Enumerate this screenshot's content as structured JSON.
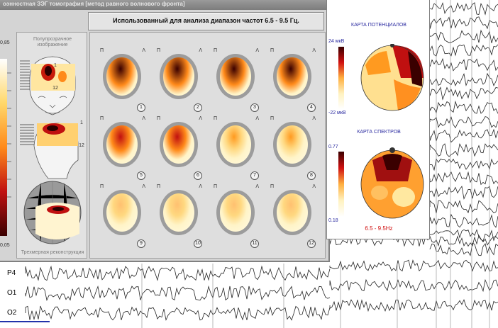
{
  "window": {
    "title": "оэнностная ЗЭГ томография [метод равного волнового фронта]"
  },
  "header": {
    "range_text": "Использованный для анализа диапазон частот 6.5 - 9.5 Гц."
  },
  "left_scale": {
    "max": "0,85",
    "min": "0,05"
  },
  "left_panel": {
    "top_label_1": "Полупрозрачное",
    "top_label_2": "изображение",
    "marker_1a": "1",
    "marker_12a": "12",
    "marker_1b": "1",
    "marker_12b": "12",
    "bottom_label": "Трехмерная реконструкция"
  },
  "grid": {
    "left_mark": "П",
    "right_mark": "Λ",
    "cells": [
      {
        "num": "1",
        "intensity": 0.95
      },
      {
        "num": "2",
        "intensity": 0.9
      },
      {
        "num": "3",
        "intensity": 0.85
      },
      {
        "num": "4",
        "intensity": 0.8
      },
      {
        "num": "5",
        "intensity": 0.6
      },
      {
        "num": "6",
        "intensity": 0.5
      },
      {
        "num": "7",
        "intensity": 0.35
      },
      {
        "num": "8",
        "intensity": 0.3
      },
      {
        "num": "9",
        "intensity": 0.2
      },
      {
        "num": "10",
        "intensity": 0.2
      },
      {
        "num": "11",
        "intensity": 0.2
      },
      {
        "num": "12",
        "intensity": 0.2
      }
    ]
  },
  "maps": {
    "potentials_title": "КАРТА ПОТЕНЦИАЛОВ",
    "pot_max": "24 мкВ",
    "pot_min": "-22 мкВ",
    "spectra_title": "КАРТА СПЕКТРОВ",
    "spec_max": "0.77",
    "spec_min": "0.18",
    "freq_label": "6.5 - 9.5Hz"
  },
  "eeg": {
    "channels": [
      "P4",
      "O1",
      "O2"
    ]
  },
  "colors": {
    "panel_bg": "#dedede",
    "map_title": "#2a2aa0",
    "freq_label": "#d01010"
  }
}
